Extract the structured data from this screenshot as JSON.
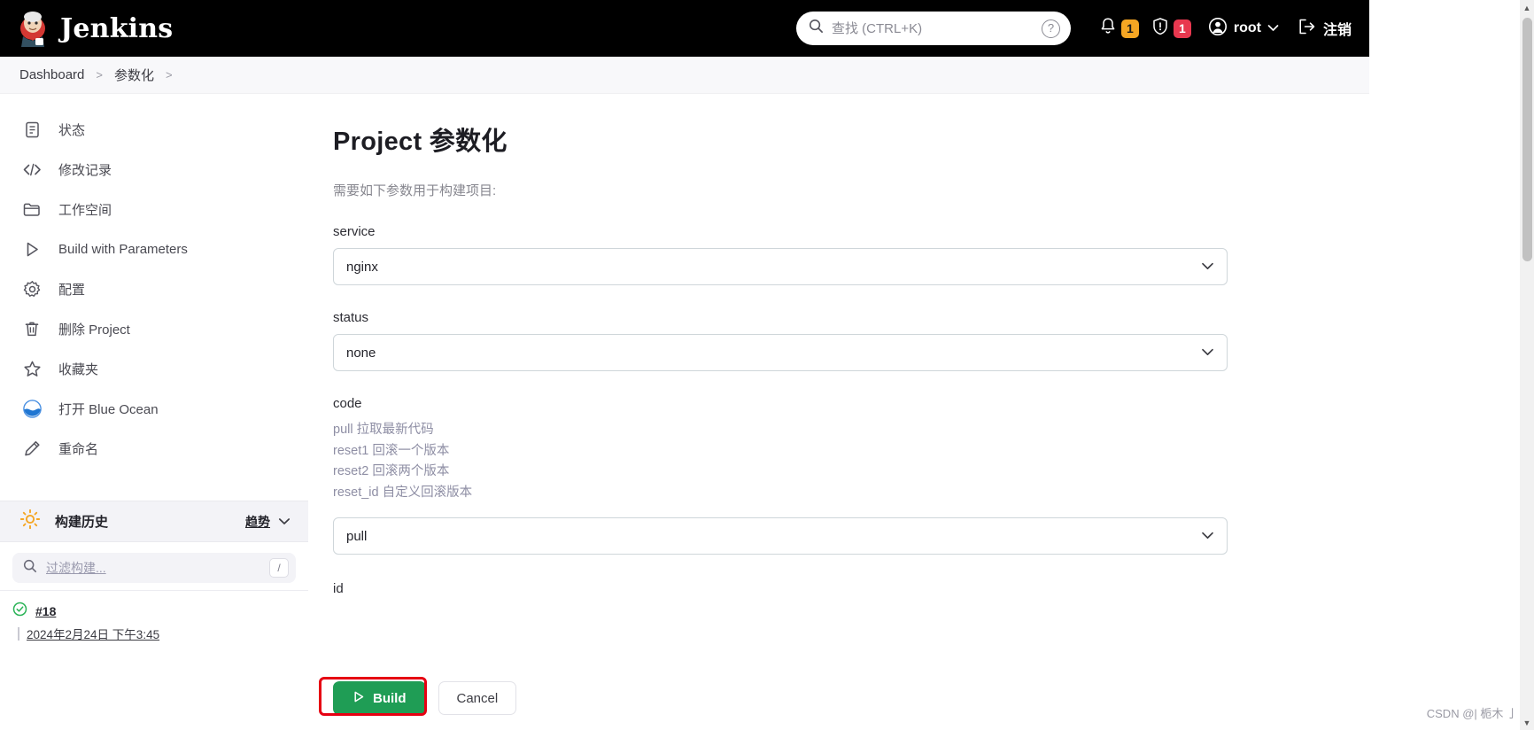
{
  "header": {
    "brand": "Jenkins",
    "search_placeholder": "查找 (CTRL+K)",
    "search_value": "",
    "help_glyph": "?",
    "notification_count": "1",
    "security_count": "1",
    "user_name": "root",
    "logout_label": "注销",
    "colors": {
      "bar": "#000000",
      "notification_badge": "#f5a623",
      "security_badge": "#e8384f"
    }
  },
  "breadcrumb": {
    "items": [
      "Dashboard",
      "参数化"
    ],
    "separator": ">"
  },
  "sidebar": {
    "items": [
      {
        "label": "状态",
        "icon": "document-icon"
      },
      {
        "label": "修改记录",
        "icon": "code-icon"
      },
      {
        "label": "工作空间",
        "icon": "folder-icon"
      },
      {
        "label": "Build with Parameters",
        "icon": "play-icon"
      },
      {
        "label": "配置",
        "icon": "gear-icon"
      },
      {
        "label": "删除 Project",
        "icon": "trash-icon"
      },
      {
        "label": "收藏夹",
        "icon": "star-icon"
      },
      {
        "label": "打开 Blue Ocean",
        "icon": "blue-ocean-icon"
      },
      {
        "label": "重命名",
        "icon": "pencil-icon"
      }
    ],
    "build_history": {
      "title": "构建历史",
      "icon": "sun-weather-icon",
      "trend_label": "趋势",
      "filter_placeholder": "过滤构建...",
      "filter_value": "",
      "filter_shortcut": "/",
      "builds": [
        {
          "number": "#18",
          "status": "success",
          "date": "2024年2月24日 下午3:45"
        }
      ]
    }
  },
  "main": {
    "title": "Project 参数化",
    "description": "需要如下参数用于构建项目:",
    "fields": [
      {
        "name": "service",
        "label": "service",
        "value": "nginx",
        "type": "select",
        "descriptions": []
      },
      {
        "name": "status",
        "label": "status",
        "value": "none",
        "type": "select",
        "descriptions": []
      },
      {
        "name": "code",
        "label": "code",
        "value": "pull",
        "type": "select",
        "descriptions": [
          "pull 拉取最新代码",
          "reset1 回滚一个版本",
          "reset2 回滚两个版本",
          "reset_id 自定义回滚版本"
        ]
      },
      {
        "name": "id",
        "label": "id",
        "value": "",
        "type": "text",
        "descriptions": []
      }
    ],
    "actions": {
      "build_label": "Build",
      "cancel_label": "Cancel",
      "build_color": "#1f9d55",
      "annotation_color": "#e60012"
    }
  },
  "watermark": "CSDN @| 栀木 亅"
}
